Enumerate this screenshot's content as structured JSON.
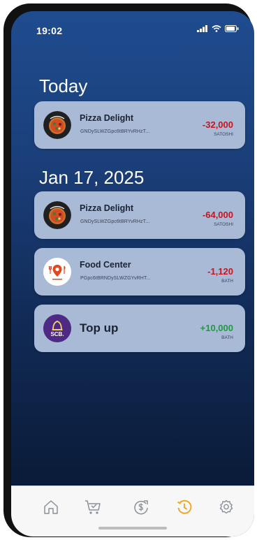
{
  "status_bar": {
    "time": "19:02"
  },
  "sections": [
    {
      "title": "Today"
    },
    {
      "title": "Jan 17, 2025"
    }
  ],
  "transactions": [
    {
      "merchant": "Pizza Delight",
      "address": "GNDySLWZGpc6tBRYvRHzT...",
      "amount": "-32,000",
      "unit": "SATOSHI",
      "type": "debit"
    },
    {
      "merchant": "Pizza Delight",
      "address": "GNDySLWZGpc6tBRYvRHzT...",
      "amount": "-64,000",
      "unit": "SATOSHI",
      "type": "debit"
    },
    {
      "merchant": "Food Center",
      "address": "PGpc6tBRNDySLWZGYvRHT...",
      "amount": "-1,120",
      "unit": "BATH",
      "type": "debit"
    },
    {
      "merchant": "Top up",
      "address": "",
      "amount": "+10,000",
      "unit": "BATH",
      "type": "credit",
      "logo_text": "SCB."
    }
  ],
  "tab_bar": {
    "items": [
      {
        "icon": "home-icon",
        "active": false
      },
      {
        "icon": "cart-icon",
        "active": false
      },
      {
        "icon": "dollar-exchange-icon",
        "active": false
      },
      {
        "icon": "history-icon",
        "active": true
      },
      {
        "icon": "settings-gear-icon",
        "active": false
      }
    ]
  },
  "colors": {
    "debit": "#c9131e",
    "credit": "#1f9a3d",
    "active_tab": "#f5a623",
    "card_bg": "#a9bad7"
  }
}
